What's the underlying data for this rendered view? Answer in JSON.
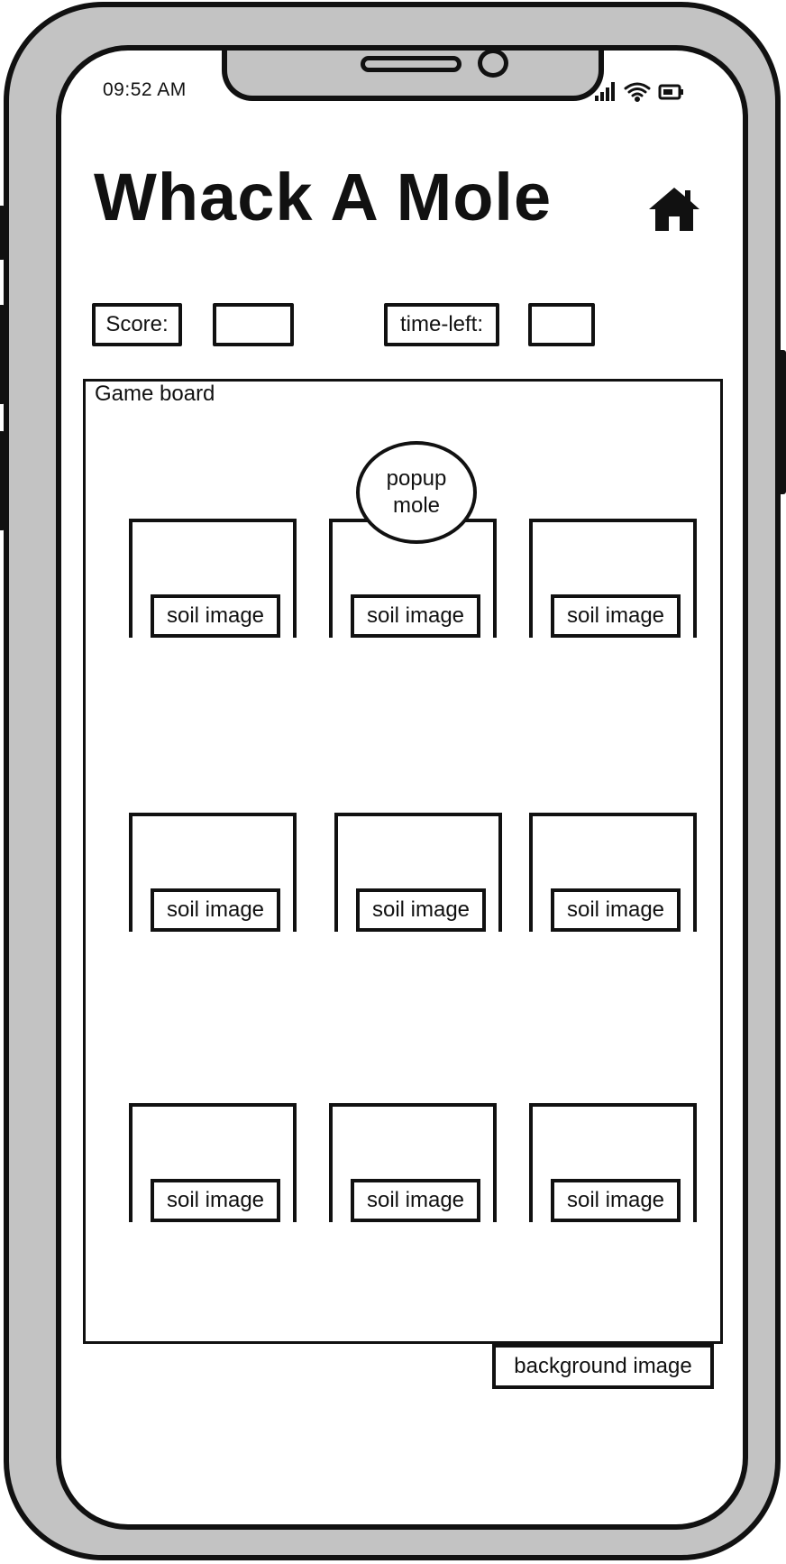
{
  "status_bar": {
    "time": "09:52 AM",
    "icons": [
      "signal-icon",
      "wifi-icon",
      "battery-icon"
    ]
  },
  "header": {
    "title": "Whack A Mole",
    "home_icon": "home-icon"
  },
  "scoreboard": {
    "score_label": "Score:",
    "score_value": "",
    "time_label": "time-left:",
    "time_value": ""
  },
  "game_board": {
    "label": "Game board",
    "mole_label": "popup mole",
    "holes": [
      {
        "soil_label": "soil image"
      },
      {
        "soil_label": "soil image"
      },
      {
        "soil_label": "soil image"
      },
      {
        "soil_label": "soil image"
      },
      {
        "soil_label": "soil image"
      },
      {
        "soil_label": "soil image"
      },
      {
        "soil_label": "soil image"
      },
      {
        "soil_label": "soil image"
      },
      {
        "soil_label": "soil image"
      }
    ],
    "background_label": "background image"
  }
}
